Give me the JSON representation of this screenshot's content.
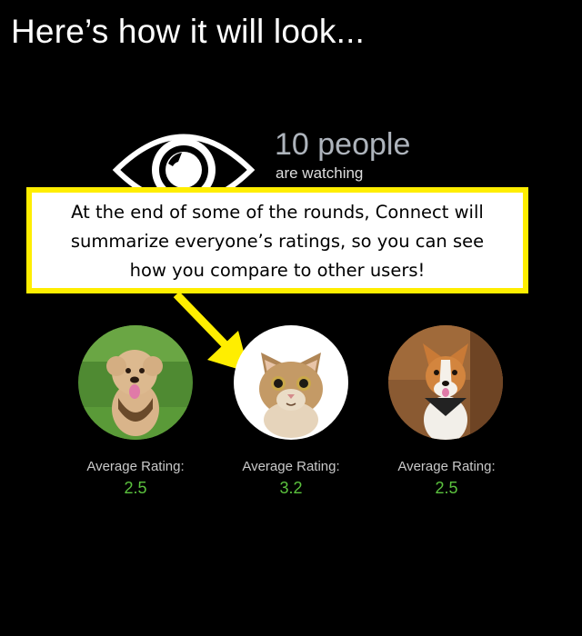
{
  "slide": {
    "title": "Here’s how it will look..."
  },
  "watchers": {
    "count_text": "10 people",
    "subtitle": "are watching",
    "icon": "eye-icon",
    "color": "#aeb4bc"
  },
  "callout": {
    "line1": "At the end of some of the rounds, Connect will",
    "line2": "summarize everyone’s ratings, so you can see",
    "line3": "how you compare to other users!",
    "border_color": "#ffee00"
  },
  "pets": [
    {
      "name": "dog-fluffy",
      "rating_label": "Average Rating:",
      "rating_value": "2.5"
    },
    {
      "name": "cat",
      "rating_label": "Average Rating:",
      "rating_value": "3.2"
    },
    {
      "name": "dog-corgi",
      "rating_label": "Average Rating:",
      "rating_value": "2.5"
    }
  ],
  "colors": {
    "background": "#000000",
    "rating_value": "#5bc23e",
    "arrow": "#ffee00"
  }
}
